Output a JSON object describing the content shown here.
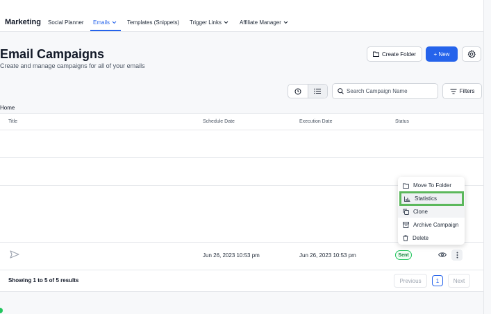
{
  "nav": {
    "brand": "Marketing",
    "items": [
      {
        "label": "Social Planner"
      },
      {
        "label": "Emails"
      },
      {
        "label": "Templates (Snippets)"
      },
      {
        "label": "Trigger Links"
      },
      {
        "label": "Affiliate Manager"
      }
    ]
  },
  "header": {
    "title": "Email Campaigns",
    "subtitle": "Create and manage campaigns for all of your emails",
    "create_folder": "Create Folder",
    "new": "+ New"
  },
  "toolbar": {
    "search_placeholder": "Search Campaign Name",
    "filters": "Filters"
  },
  "breadcrumb": "Home",
  "table": {
    "columns": [
      "Title",
      "Schedule Date",
      "Execution Date",
      "Status"
    ],
    "rows": [
      {
        "schedule_date": "Jun 26, 2023 10:53 pm",
        "execution_date": "Jun 26, 2023 10:53 pm",
        "status": "Sent"
      }
    ],
    "footer": "Showing 1 to 5 of 5 results",
    "pagination": {
      "prev": "Previous",
      "page": "1",
      "next": "Next"
    }
  },
  "menu": {
    "items": [
      {
        "label": "Move To Folder",
        "icon": "folder-icon"
      },
      {
        "label": "Statistics",
        "icon": "chart-icon"
      },
      {
        "label": "Clone",
        "icon": "copy-icon"
      },
      {
        "label": "Archive Campaign",
        "icon": "archive-icon"
      },
      {
        "label": "Delete",
        "icon": "trash-icon"
      }
    ]
  },
  "colors": {
    "accent": "#2563eb",
    "success": "#22c55e",
    "highlight": "#5cb85c"
  }
}
